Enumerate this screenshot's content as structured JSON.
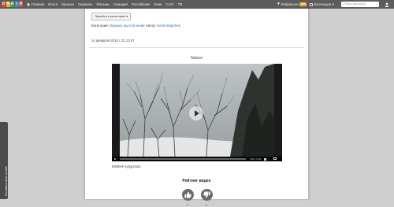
{
  "header": {
    "logo_letters": [
      "O",
      "N",
      "A",
      "I",
      "R"
    ],
    "logo_colors": [
      "#e8452c",
      "#f6a821",
      "#3aa84a",
      "#2d8ed6",
      "#e8452c"
    ],
    "nav": [
      "Главная",
      "Блоги",
      "Музыка",
      "Сериалы",
      "Фильмы",
      "Комедия",
      "Российские",
      "Клип",
      "CLIO",
      "TB"
    ],
    "favorites_label": "Избранное",
    "favorites_badge": "new",
    "collections_label": "Коллекция",
    "search_placeholder": "Поиск фильмов"
  },
  "feedback_tab": "Оставьте ваш отзыв",
  "page": {
    "category_button": "Перейти в категорию ▾",
    "category_prefix": "Категория:",
    "category_link": "Музыка, выступления",
    "author_prefix": "Автор:",
    "author_link": "Nazik Batyrbek",
    "date": "14 февраля 2018 г. 21:12:57",
    "video_title": "Nature",
    "caption": "Bishkek Kyrgyzstan",
    "rating_title": "Рейтинг видео",
    "likes": "0",
    "dislikes": "0"
  },
  "player": {
    "progress_fraction": 0.0,
    "time": "0:00 / 0:18"
  }
}
